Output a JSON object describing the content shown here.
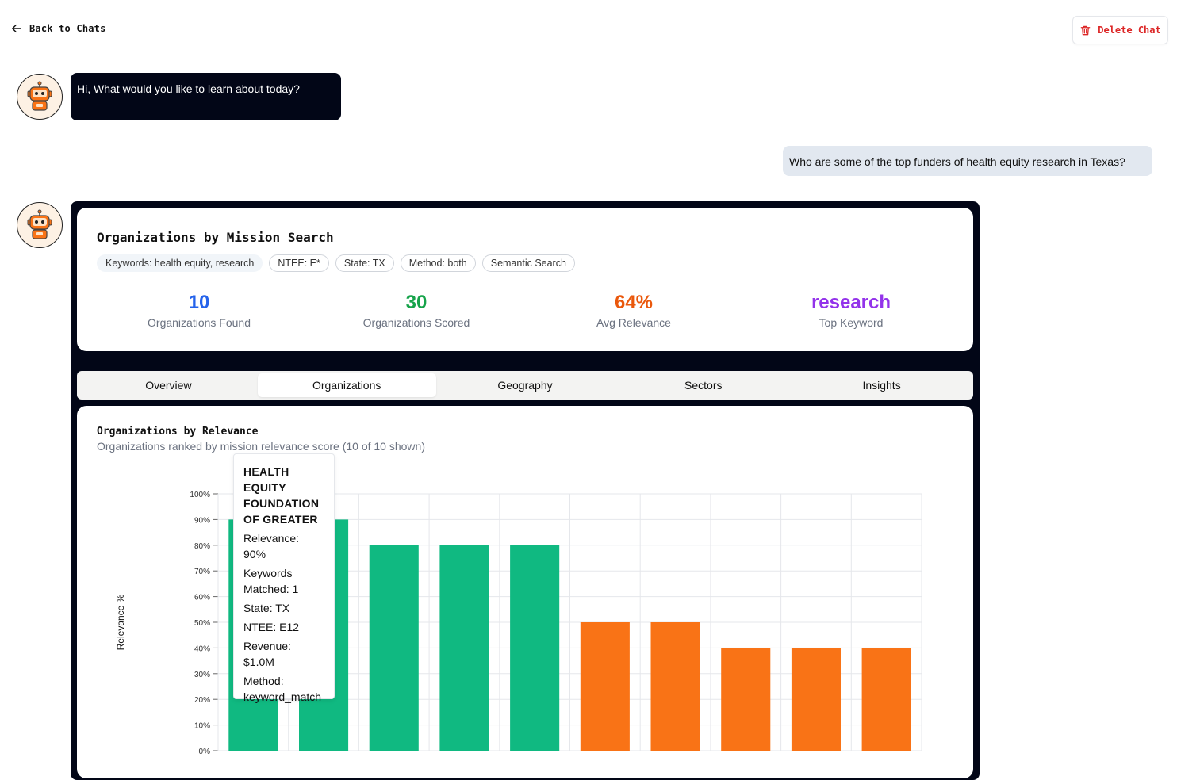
{
  "header": {
    "back_label": "Back to Chats",
    "delete_label": "Delete Chat"
  },
  "messages": {
    "bot_greeting": "Hi, What would you like to learn about today?",
    "user_question": "Who are some of the top funders of health equity research in Texas?"
  },
  "summary": {
    "title": "Organizations by Mission Search",
    "chips": [
      "Keywords: health equity, research",
      "NTEE: E*",
      "State: TX",
      "Method: both",
      "Semantic Search"
    ],
    "stats": [
      {
        "value": "10",
        "label": "Organizations Found",
        "color": "#2563eb"
      },
      {
        "value": "30",
        "label": "Organizations Scored",
        "color": "#16a34a"
      },
      {
        "value": "64%",
        "label": "Avg Relevance",
        "color": "#ea580c"
      },
      {
        "value": "research",
        "label": "Top Keyword",
        "color": "#9333ea"
      }
    ]
  },
  "tabs": [
    {
      "label": "Overview",
      "active": false
    },
    {
      "label": "Organizations",
      "active": true
    },
    {
      "label": "Geography",
      "active": false
    },
    {
      "label": "Sectors",
      "active": false
    },
    {
      "label": "Insights",
      "active": false
    }
  ],
  "chart_card": {
    "title": "Organizations by Relevance",
    "subtitle": "Organizations ranked by mission relevance score (10 of 10 shown)"
  },
  "chart_data": {
    "type": "bar",
    "ylabel": "Relevance %",
    "xlabel": "",
    "ylim": [
      0,
      100
    ],
    "y_ticks": [
      "0%",
      "10%",
      "20%",
      "30%",
      "40%",
      "50%",
      "60%",
      "70%",
      "80%",
      "90%",
      "100%"
    ],
    "grid": true,
    "values": [
      90,
      90,
      80,
      80,
      80,
      50,
      50,
      40,
      40,
      40
    ],
    "colors": {
      "high": "#10b981",
      "medium": "#f97316"
    },
    "high_threshold": 60
  },
  "tooltip": {
    "name_lines": [
      "HEALTH",
      "EQUITY",
      "FOUNDATION",
      "OF GREATER"
    ],
    "lines": [
      "Relevance:",
      "90%",
      "Keywords",
      "Matched: 1",
      "State: TX",
      "NTEE: E12",
      "Revenue: $1.0M",
      "Method:",
      "keyword_match"
    ]
  }
}
